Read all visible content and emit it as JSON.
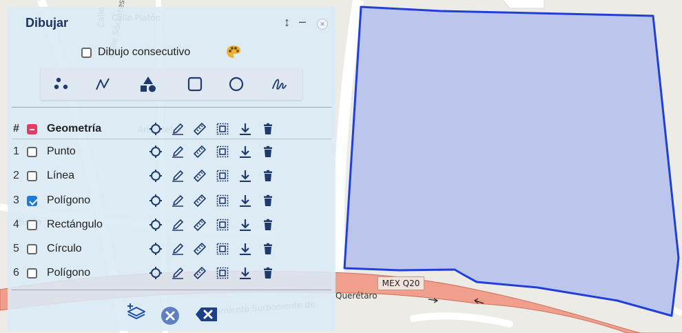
{
  "panel": {
    "title": "Dibujar",
    "consecutive_label": "Dibujo consecutivo",
    "header": {
      "number_symbol": "#",
      "label": "Geometría"
    },
    "rows": [
      {
        "number": "1",
        "label": "Punto",
        "checked": false
      },
      {
        "number": "2",
        "label": "Línea",
        "checked": false
      },
      {
        "number": "3",
        "label": "Polígono",
        "checked": true
      },
      {
        "number": "4",
        "label": "Rectángulo",
        "checked": false
      },
      {
        "number": "5",
        "label": "Círculo",
        "checked": false
      },
      {
        "number": "6",
        "label": "Polígono",
        "checked": false
      }
    ],
    "tools": [
      "point-icon",
      "line-icon",
      "shapes-icon",
      "rectangle-icon",
      "circle-icon",
      "freehand-icon"
    ],
    "row_actions": [
      "locate-icon",
      "edit-icon",
      "measure-icon",
      "select-icon",
      "download-icon",
      "delete-icon"
    ],
    "footer_actions": [
      "add-layers-icon",
      "close-circle-icon",
      "backspace-icon"
    ]
  },
  "map": {
    "road_ref": "MEX Q20",
    "road_label_qro": "Querétaro",
    "labels": [
      "Calle Platón",
      "Calle Sócrates",
      "Aristóteles",
      "Misión",
      "Calle",
      "Libramiento Surponiente de"
    ],
    "polygon_fill": "#bcc6ec",
    "polygon_stroke": "#1f3fd8",
    "road_fill": "#ef9f8b"
  }
}
